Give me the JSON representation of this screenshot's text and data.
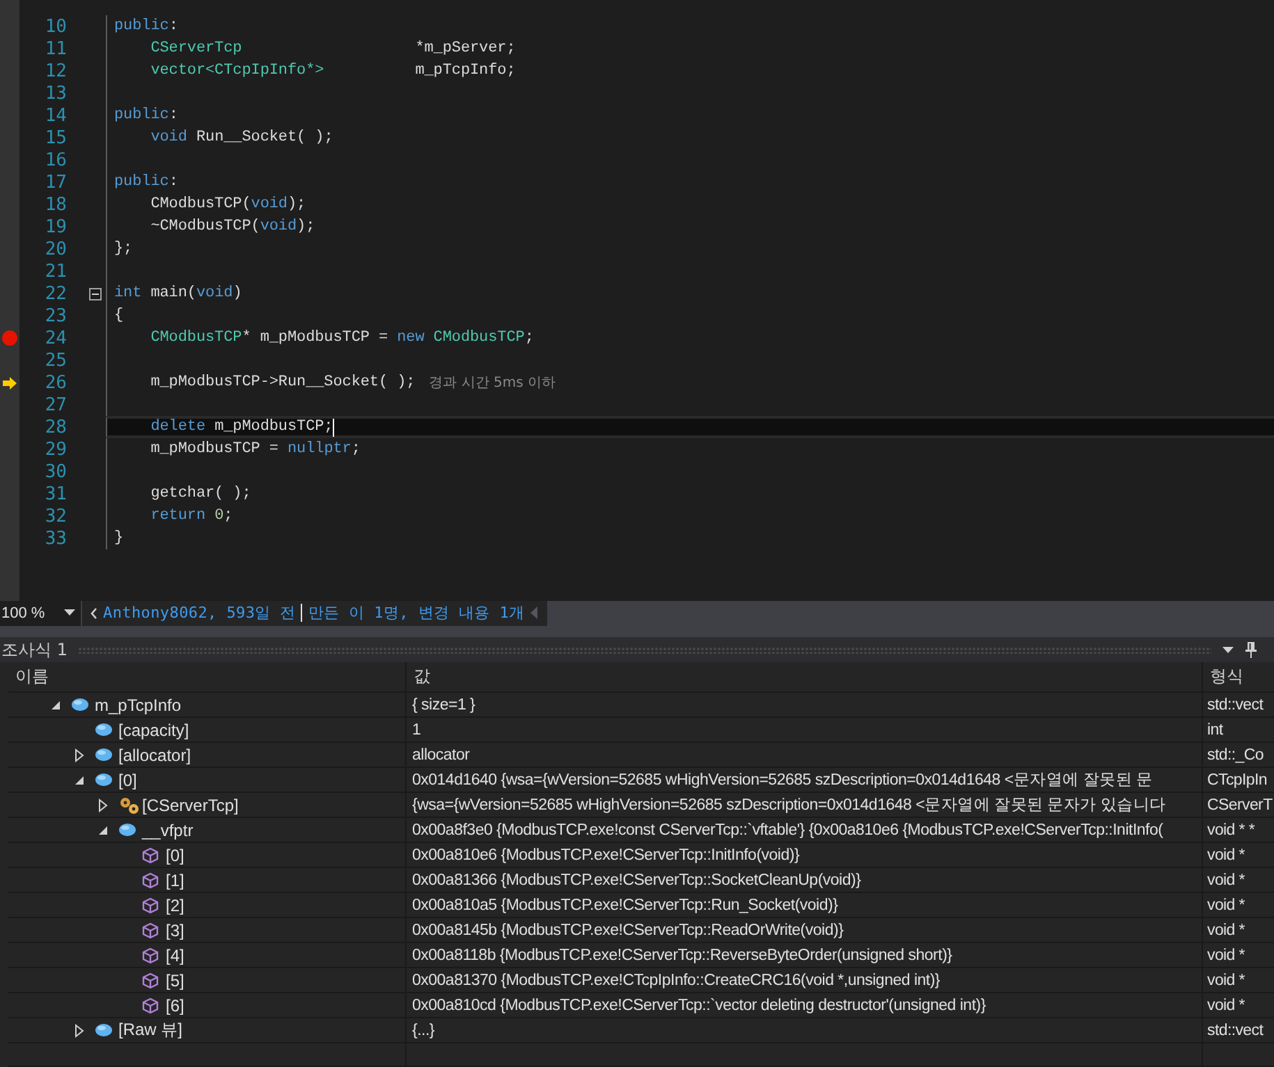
{
  "editor": {
    "lines": [
      {
        "number": "10",
        "tokens": [
          {
            "kind": "keyword",
            "text": "public"
          },
          {
            "kind": "plain",
            "text": ":"
          }
        ],
        "breakpoint": false,
        "next": false,
        "caret": false,
        "fold": false
      },
      {
        "number": "11",
        "tokens": [
          {
            "kind": "type",
            "text": "    CServerTcp"
          },
          {
            "kind": "plain",
            "text": "                   *m_pServer;"
          }
        ],
        "breakpoint": false,
        "next": false,
        "caret": false,
        "fold": false
      },
      {
        "number": "12",
        "tokens": [
          {
            "kind": "type",
            "text": "    vector<CTcpIpInfo*>"
          },
          {
            "kind": "plain",
            "text": "          m_pTcpInfo;"
          }
        ],
        "breakpoint": false,
        "next": false,
        "caret": false,
        "fold": false
      },
      {
        "number": "13",
        "breakpoint": false,
        "next": false,
        "caret": false,
        "fold": false
      },
      {
        "number": "14",
        "tokens": [
          {
            "kind": "keyword",
            "text": "public"
          },
          {
            "kind": "plain",
            "text": ":"
          }
        ],
        "breakpoint": false,
        "next": false,
        "caret": false,
        "fold": false
      },
      {
        "number": "15",
        "tokens": [
          {
            "kind": "keyword",
            "text": "    void"
          },
          {
            "kind": "plain",
            "text": " Run__Socket( );"
          }
        ],
        "breakpoint": false,
        "next": false,
        "caret": false,
        "fold": false
      },
      {
        "number": "16",
        "breakpoint": false,
        "next": false,
        "caret": false,
        "fold": false
      },
      {
        "number": "17",
        "tokens": [
          {
            "kind": "keyword",
            "text": "public"
          },
          {
            "kind": "plain",
            "text": ":"
          }
        ],
        "breakpoint": false,
        "next": false,
        "caret": false,
        "fold": false
      },
      {
        "number": "18",
        "tokens": [
          {
            "kind": "plain",
            "text": "    CModbusTCP("
          },
          {
            "kind": "keyword",
            "text": "void"
          },
          {
            "kind": "plain",
            "text": ");"
          }
        ],
        "breakpoint": false,
        "next": false,
        "caret": false,
        "fold": false
      },
      {
        "number": "19",
        "tokens": [
          {
            "kind": "plain",
            "text": "    ~CModbusTCP("
          },
          {
            "kind": "keyword",
            "text": "void"
          },
          {
            "kind": "plain",
            "text": ");"
          }
        ],
        "breakpoint": false,
        "next": false,
        "caret": false,
        "fold": false
      },
      {
        "number": "20",
        "tokens": [
          {
            "kind": "plain",
            "text": "};"
          }
        ],
        "breakpoint": false,
        "next": false,
        "caret": false,
        "fold": false
      },
      {
        "number": "21",
        "breakpoint": false,
        "next": false,
        "caret": false,
        "fold": false
      },
      {
        "number": "22",
        "tokens": [
          {
            "kind": "keyword",
            "text": "int"
          },
          {
            "kind": "plain",
            "text": " main("
          },
          {
            "kind": "keyword",
            "text": "void"
          },
          {
            "kind": "plain",
            "text": ")"
          }
        ],
        "breakpoint": false,
        "next": false,
        "caret": false,
        "fold": true
      },
      {
        "number": "23",
        "tokens": [
          {
            "kind": "plain",
            "text": "{"
          }
        ],
        "breakpoint": false,
        "next": false,
        "caret": false,
        "fold": false
      },
      {
        "number": "24",
        "tokens": [
          {
            "kind": "type",
            "text": "    CModbusTCP"
          },
          {
            "kind": "plain",
            "text": "* m_pModbusTCP = "
          },
          {
            "kind": "keyword",
            "text": "new"
          },
          {
            "kind": "type",
            "text": " CModbusTCP"
          },
          {
            "kind": "plain",
            "text": ";"
          }
        ],
        "breakpoint": true,
        "next": false,
        "caret": false,
        "fold": false
      },
      {
        "number": "25",
        "breakpoint": false,
        "next": false,
        "caret": false,
        "fold": false
      },
      {
        "number": "26",
        "tokens": [
          {
            "kind": "plain",
            "text": "    m_pModbusTCP->Run__Socket( );"
          }
        ],
        "hint": "경과 시간 5ms 이하",
        "breakpoint": false,
        "next": true,
        "caret": false,
        "fold": false
      },
      {
        "number": "27",
        "breakpoint": false,
        "next": false,
        "caret": false,
        "fold": false
      },
      {
        "number": "28",
        "tokens": [
          {
            "kind": "keyword",
            "text": "    delete"
          },
          {
            "kind": "plain",
            "text": " m_pModbusTCP;"
          }
        ],
        "breakpoint": false,
        "next": false,
        "caret": true,
        "fold": false
      },
      {
        "number": "29",
        "tokens": [
          {
            "kind": "plain",
            "text": "    m_pModbusTCP = "
          },
          {
            "kind": "keyword",
            "text": "nullptr"
          },
          {
            "kind": "plain",
            "text": ";"
          }
        ],
        "breakpoint": false,
        "next": false,
        "caret": false,
        "fold": false
      },
      {
        "number": "30",
        "breakpoint": false,
        "next": false,
        "caret": false,
        "fold": false
      },
      {
        "number": "31",
        "tokens": [
          {
            "kind": "plain",
            "text": "    getchar( );"
          }
        ],
        "breakpoint": false,
        "next": false,
        "caret": false,
        "fold": false
      },
      {
        "number": "32",
        "tokens": [
          {
            "kind": "keyword",
            "text": "    return"
          },
          {
            "kind": "number",
            "text": " 0"
          },
          {
            "kind": "plain",
            "text": ";"
          }
        ],
        "breakpoint": false,
        "next": false,
        "caret": false,
        "fold": false
      },
      {
        "number": "33",
        "tokens": [
          {
            "kind": "plain",
            "text": "}"
          }
        ],
        "breakpoint": false,
        "next": false,
        "caret": false,
        "fold": false
      }
    ]
  },
  "status_bar": {
    "zoom": "100 %",
    "codelens_author": "Anthony8062, 593일 전",
    "codelens_changes": "만든 이 1명, 변경 내용 1개"
  },
  "watch": {
    "title": "조사식 1",
    "columns": [
      "이름",
      "값",
      "형식"
    ],
    "rows": [
      {
        "name": "m_pTcpInfo",
        "value": "{ size=1 }",
        "type": "std::vect",
        "kind": "field",
        "expanded": true,
        "children": [
          {
            "name": "[capacity]",
            "value": "1",
            "type": "int",
            "kind": "field"
          },
          {
            "name": "[allocator]",
            "value": "allocator",
            "type": "std::_Co",
            "kind": "field",
            "expanded": false
          },
          {
            "name": "[0]",
            "value": "0x014d1640 {wsa={wVersion=52685 wHighVersion=52685 szDescription=0x014d1648  <문자열에 잘못된 문",
            "type": "CTcpIpIn",
            "kind": "field",
            "expanded": true,
            "children": [
              {
                "name": "[CServerTcp]",
                "value": "{wsa={wVersion=52685 wHighVersion=52685 szDescription=0x014d1648  <문자열에 잘못된 문자가 있습니다",
                "type": "CServerT",
                "kind": "base",
                "expanded": false
              },
              {
                "name": "__vfptr",
                "value": "0x00a8f3e0 {ModbusTCP.exe!const CServerTcp::`vftable'} {0x00a810e6 {ModbusTCP.exe!CServerTcp::InitInfo(",
                "type": "void * *",
                "kind": "field",
                "expanded": true,
                "children": [
                  {
                    "name": "[0]",
                    "value": "0x00a810e6 {ModbusTCP.exe!CServerTcp::InitInfo(void)}",
                    "type": "void *",
                    "kind": "method"
                  },
                  {
                    "name": "[1]",
                    "value": "0x00a81366 {ModbusTCP.exe!CServerTcp::SocketCleanUp(void)}",
                    "type": "void *",
                    "kind": "method"
                  },
                  {
                    "name": "[2]",
                    "value": "0x00a810a5 {ModbusTCP.exe!CServerTcp::Run_Socket(void)}",
                    "type": "void *",
                    "kind": "method"
                  },
                  {
                    "name": "[3]",
                    "value": "0x00a8145b {ModbusTCP.exe!CServerTcp::ReadOrWrite(void)}",
                    "type": "void *",
                    "kind": "method"
                  },
                  {
                    "name": "[4]",
                    "value": "0x00a8118b {ModbusTCP.exe!CServerTcp::ReverseByteOrder(unsigned short)}",
                    "type": "void *",
                    "kind": "method"
                  },
                  {
                    "name": "[5]",
                    "value": "0x00a81370 {ModbusTCP.exe!CTcpIpInfo::CreateCRC16(void *,unsigned int)}",
                    "type": "void *",
                    "kind": "method"
                  },
                  {
                    "name": "[6]",
                    "value": "0x00a810cd {ModbusTCP.exe!CServerTcp::`vector deleting destructor'(unsigned int)}",
                    "type": "void *",
                    "kind": "method"
                  }
                ]
              }
            ]
          },
          {
            "name": "[Raw 뷰]",
            "value": "{...}",
            "type": "std::vect",
            "kind": "field",
            "expanded": false
          }
        ]
      }
    ]
  }
}
